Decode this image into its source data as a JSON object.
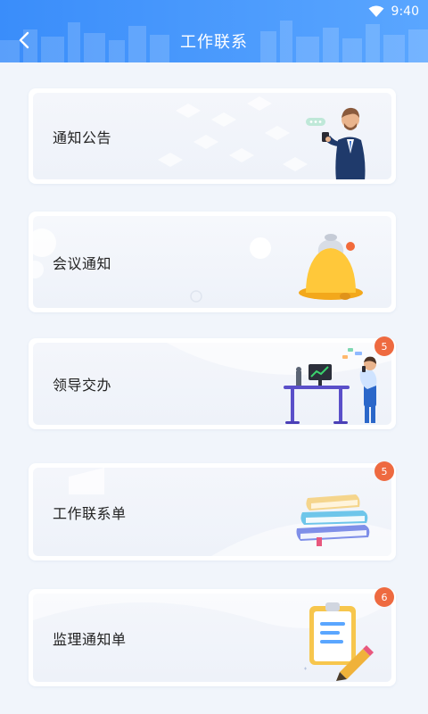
{
  "status_bar": {
    "time": "9:40"
  },
  "header": {
    "title": "工作联系"
  },
  "colors": {
    "header": "#3a8dfa",
    "badge": "#ee6a40",
    "background": "#f1f5fb"
  },
  "cards": [
    {
      "label": "通知公告",
      "icon": "businessman-phone-icon"
    },
    {
      "label": "会议通知",
      "icon": "bell-icon"
    },
    {
      "label": "领导交办",
      "icon": "man-at-desk-icon",
      "badge": "5"
    },
    {
      "label": "工作联系单",
      "icon": "book-stack-icon",
      "badge": "5"
    },
    {
      "label": "监理通知单",
      "icon": "clipboard-pencil-icon",
      "badge": "6"
    }
  ]
}
